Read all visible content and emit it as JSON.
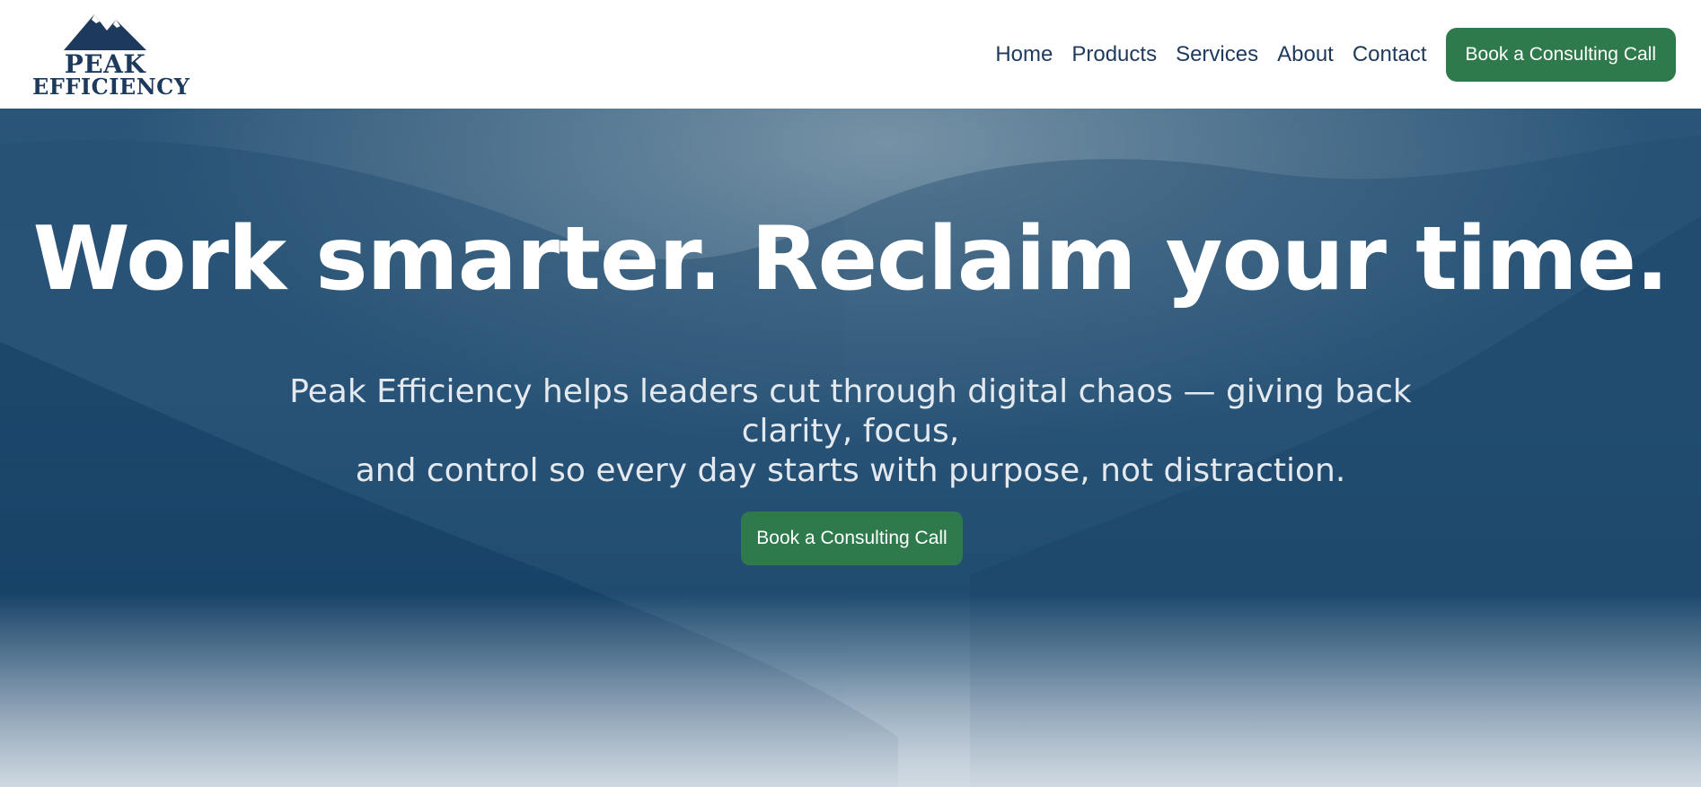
{
  "brand": {
    "name_line1": "PEAK",
    "name_line2": "EFFICIENCY",
    "logo_icon": "mountain-icon",
    "color": "#1d3a5c"
  },
  "nav": {
    "items": [
      {
        "label": "Home"
      },
      {
        "label": "Products"
      },
      {
        "label": "Services"
      },
      {
        "label": "About"
      },
      {
        "label": "Contact"
      }
    ],
    "cta_label": "Book a Consulting Call"
  },
  "hero": {
    "title": "Work smarter. Reclaim your time.",
    "subtitle_line1": "Peak Efficiency helps leaders cut through digital chaos — giving back clarity, focus,",
    "subtitle_line2": "and control so every day starts with purpose, not distraction.",
    "cta_label": "Book a Consulting Call"
  },
  "colors": {
    "accent_green": "#2f7a4d",
    "navy_text": "#1d3a5c",
    "hero_blue": "#2a5578"
  }
}
